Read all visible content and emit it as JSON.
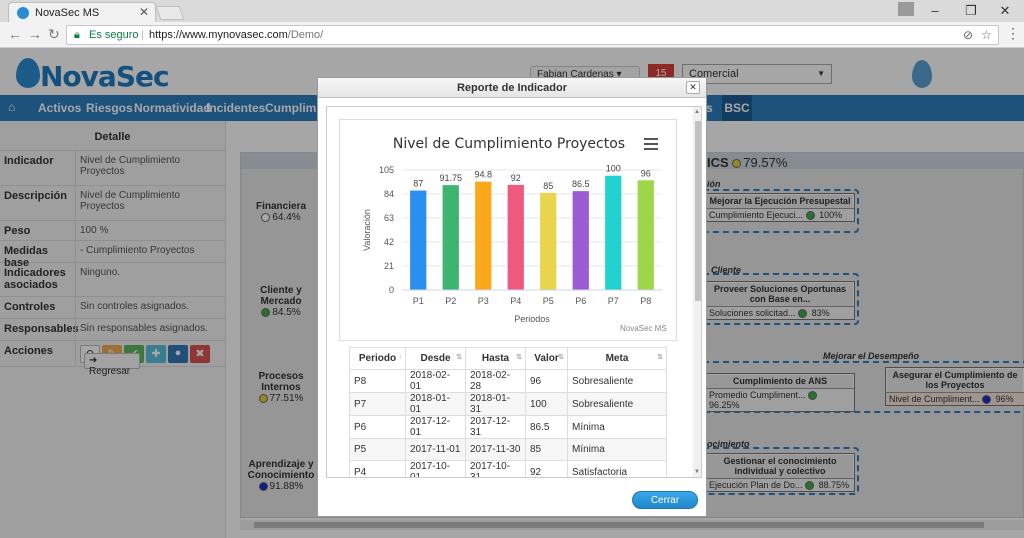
{
  "browser": {
    "tab_title": "NovaSec MS",
    "secure_label": "Es seguro",
    "url_host": "https://www.mynovasec.com",
    "url_path": "/Demo/"
  },
  "header": {
    "logo_text": "NovaSec",
    "user": "Fabian Cardenas",
    "notifications": "15",
    "area": "Comercial"
  },
  "nav": {
    "items": [
      "Activos",
      "Riesgos",
      "Normatividad",
      "Incidentes",
      "Cumplimient"
    ],
    "active": "BSC",
    "partial": "s"
  },
  "detail": {
    "title": "Detalle",
    "rows": [
      {
        "k": "Indicador",
        "v": "Nivel de Cumplimiento Proyectos"
      },
      {
        "k": "Descripción",
        "v": "Nivel de Cumplimiento Proyectos"
      },
      {
        "k": "Peso",
        "v": "100 %"
      },
      {
        "k": "Medidas base",
        "v": "- Cumplimiento Proyectos"
      },
      {
        "k": "Indicadores asociados",
        "v": "Ninguno."
      },
      {
        "k": "Controles",
        "v": "Sin controles asignados."
      },
      {
        "k": "Responsables",
        "v": "Sin responsables asignados."
      },
      {
        "k": "Acciones",
        "v": ""
      }
    ],
    "back_label": "Regresar"
  },
  "bsc": {
    "header_suffix": "ICS",
    "header_pct": "79.57%",
    "perspectives": [
      {
        "name": "Financiera",
        "pct": "64.4%",
        "color": "#ffffff"
      },
      {
        "name": "Cliente y Mercado",
        "pct": "84.5%",
        "color": "#3cb043"
      },
      {
        "name": "Procesos Internos",
        "pct": "77.51%",
        "color": "#e3d23a"
      },
      {
        "name": "Aprendizaje y Conocimiento",
        "pct": "91.88%",
        "color": "#1b2fd0"
      }
    ],
    "lanes": [
      "ión",
      "Cliente",
      "Mejorar el Desempeño",
      "ocimiento"
    ],
    "objectives": [
      {
        "title": "Mejorar la Ejecución Presupestal",
        "ind": "Cumplimiento Ejecuci...",
        "pct": "100%",
        "color": "#3cb043"
      },
      {
        "title": "Proveer Soluciones Oportunas con Base en...",
        "ind": "Soluciones solicitad...",
        "pct": "83%",
        "color": "#3cb043"
      },
      {
        "title": "Cumplimiento de ANS",
        "ind": "Promedio Cumpliment...",
        "pct": "96.25%",
        "color": "#3cb043"
      },
      {
        "title": "Asegurar el Cumplimiento de los Proyectos",
        "ind": "Nivel de Cumpliment...",
        "pct": "96%",
        "color": "#1b2fd0"
      },
      {
        "title": "Gestionar el conocimiento individual y colectivo",
        "ind": "Ejecución Plan de Do...",
        "pct": "88.75%",
        "color": "#3cb043"
      }
    ]
  },
  "modal": {
    "title": "Reporte de Indicador",
    "close_glyph": "✕",
    "close_button": "Cerrar"
  },
  "chart_data": {
    "type": "bar",
    "title": "Nivel de Cumplimiento Proyectos",
    "xlabel": "Periodos",
    "ylabel": "Valoración",
    "ylim": [
      0,
      105
    ],
    "yticks": [
      0,
      21,
      42,
      63,
      84,
      105
    ],
    "categories": [
      "P1",
      "P2",
      "P3",
      "P4",
      "P5",
      "P6",
      "P7",
      "P8"
    ],
    "values": [
      87,
      91.75,
      94.8,
      92,
      85,
      86.5,
      100,
      96
    ],
    "value_labels": [
      "87",
      "91.75",
      "94.8",
      "92",
      "85",
      "86.5",
      "100",
      "96"
    ],
    "colors": [
      "#2b8ff0",
      "#3db56f",
      "#fba81a",
      "#ee5a7e",
      "#e8d44d",
      "#9b5bd5",
      "#21d3d0",
      "#9ed64a"
    ],
    "credits": "NovaSec MS"
  },
  "table": {
    "headers": [
      "Periodo",
      "Desde",
      "Hasta",
      "Valor",
      "Meta"
    ],
    "rows": [
      [
        "P8",
        "2018-02-01",
        "2018-02-28",
        "96",
        "Sobresaliente"
      ],
      [
        "P7",
        "2018-01-01",
        "2018-01-31",
        "100",
        "Sobresaliente"
      ],
      [
        "P6",
        "2017-12-01",
        "2017-12-31",
        "86.5",
        "Mínima"
      ],
      [
        "P5",
        "2017-11-01",
        "2017-11-30",
        "85",
        "Mínima"
      ],
      [
        "P4",
        "2017-10-01",
        "2017-10-31",
        "92",
        "Satisfactoria"
      ]
    ]
  }
}
